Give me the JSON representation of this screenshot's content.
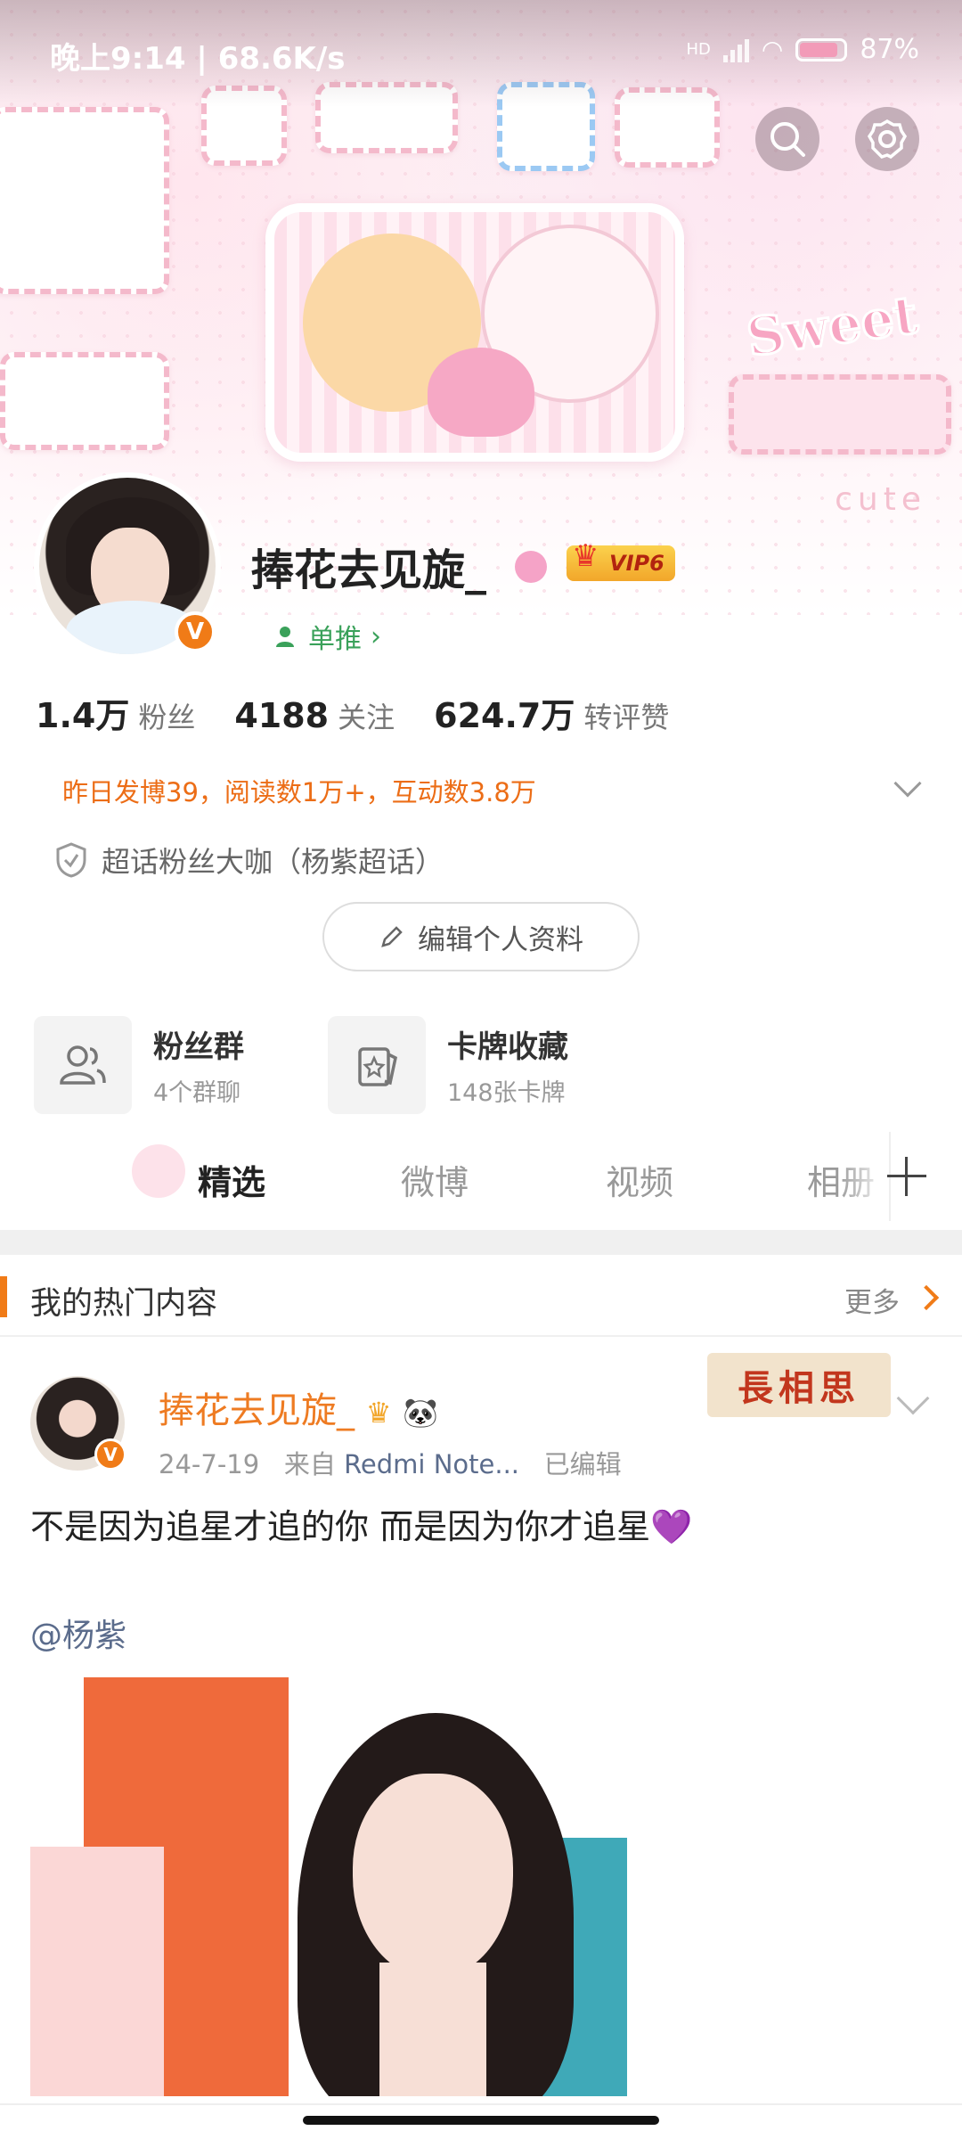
{
  "status_bar": {
    "time": "晚上9:14 | 68.6K/s",
    "network": "HD",
    "battery": "87%",
    "battery_level": 0.87
  },
  "profile": {
    "username": "捧花去见旋_",
    "vip_label": "VIP6",
    "recommend": "单推",
    "fans_count": "1.4万",
    "fans_label": "粉丝",
    "following_count": "4188",
    "following_label": "关注",
    "interactions_count": "624.7万",
    "interactions_label": "转评赞",
    "yesterday_summary": "昨日发博39，阅读数1万+，互动数3.8万",
    "chaohua_label": "超话粉丝大咖（杨紫超话）",
    "edit_profile_label": "编辑个人资料"
  },
  "banner": {
    "sticker_text_1": "Sweet",
    "sticker_text_2": "cute"
  },
  "quick_cards": [
    {
      "title": "粉丝群",
      "subtitle": "4个群聊",
      "icon": "group-icon"
    },
    {
      "title": "卡牌收藏",
      "subtitle": "148张卡牌",
      "icon": "card-collection-icon"
    }
  ],
  "tabs": [
    {
      "label": "精选",
      "active": true
    },
    {
      "label": "微博",
      "active": false
    },
    {
      "label": "视频",
      "active": false
    },
    {
      "label": "相册",
      "active": false
    }
  ],
  "hot_section": {
    "title": "我的热门内容",
    "more_label": "更多"
  },
  "post": {
    "author": "捧花去见旋_",
    "date": "24-7-19",
    "from_prefix": "来自",
    "source": "Redmi Note...",
    "edited": "已编辑",
    "stamp_text": "長相思",
    "text": "不是因为追星才追的你 而是因为你才追星💜",
    "mention": "@杨紫"
  },
  "colors": {
    "accent_orange": "#f07b17",
    "link_blue": "#5b6c8c",
    "recommend_green": "#3aa15a"
  }
}
